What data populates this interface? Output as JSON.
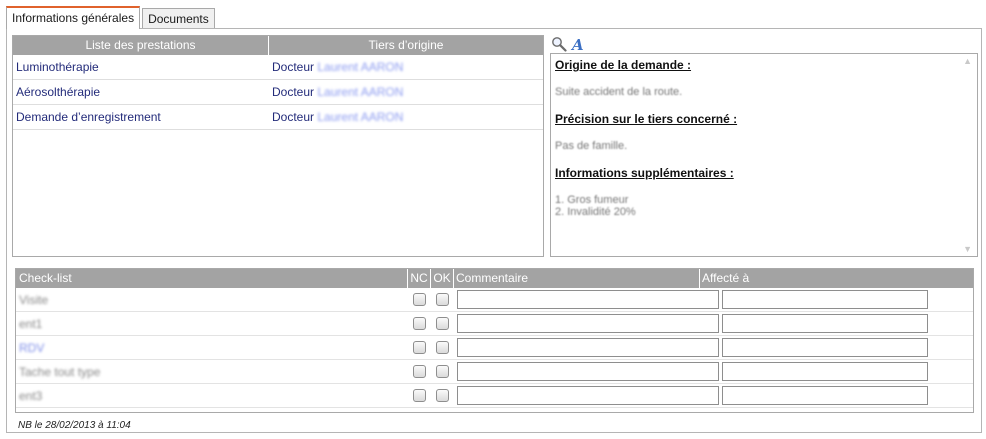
{
  "tabs": [
    {
      "label": "Informations générales",
      "active": true
    },
    {
      "label": "Documents",
      "active": false
    }
  ],
  "prestations": {
    "headers": [
      "Liste des prestations",
      "Tiers d’origine"
    ],
    "rows": [
      {
        "name": "Luminothérapie",
        "title": "Docteur",
        "person": "Laurent AARON"
      },
      {
        "name": "Aérosolthérapie",
        "title": "Docteur",
        "person": "Laurent AARON"
      },
      {
        "name": "Demande d’enregistrement",
        "title": "Docteur",
        "person": "Laurent AARON"
      }
    ]
  },
  "tools": {
    "search_icon": "magnifier-icon",
    "font_icon": "font-style-icon"
  },
  "notes": {
    "heading1": "Origine de la demande :",
    "text1": "Suite accident de la route.",
    "heading2": "Précision sur le tiers concerné :",
    "text2": "Pas de famille.",
    "heading3": "Informations supplémentaires :",
    "list": [
      "1. Gros fumeur",
      "2. Invalidité 20%"
    ]
  },
  "checklist": {
    "headers": {
      "item": "Check-list",
      "nc": "NC",
      "ok": "OK",
      "comment": "Commentaire",
      "assigned": "Affecté à"
    },
    "rows": [
      {
        "label": "Visite"
      },
      {
        "label": "ent1"
      },
      {
        "label": "RDV"
      },
      {
        "label": "Tache tout type"
      },
      {
        "label": "ent3"
      }
    ]
  },
  "footer": "NB le 28/02/2013 à 11:04",
  "colors": {
    "accent": "#e0622c",
    "header_bg": "#a3a3a3",
    "link": "#232b7a"
  }
}
